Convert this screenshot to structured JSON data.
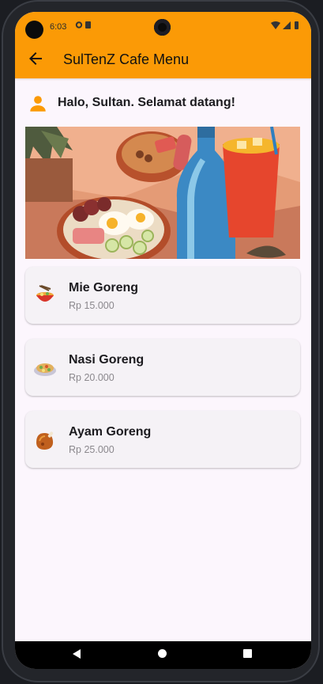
{
  "status_bar": {
    "time": "6:03"
  },
  "app_bar": {
    "title": "SulTenZ Cafe Menu"
  },
  "greeting": {
    "text": "Halo, Sultan. Selamat datang!"
  },
  "menu": [
    {
      "name": "Mie Goreng",
      "price": "Rp 15.000",
      "icon": "noodle-bowl-icon"
    },
    {
      "name": "Nasi Goreng",
      "price": "Rp 20.000",
      "icon": "fried-rice-icon"
    },
    {
      "name": "Ayam Goreng",
      "price": "Rp 25.000",
      "icon": "fried-chicken-icon"
    }
  ],
  "colors": {
    "accent": "#fb9a06",
    "background": "#fcf6fd",
    "card": "#f5f2f6"
  }
}
